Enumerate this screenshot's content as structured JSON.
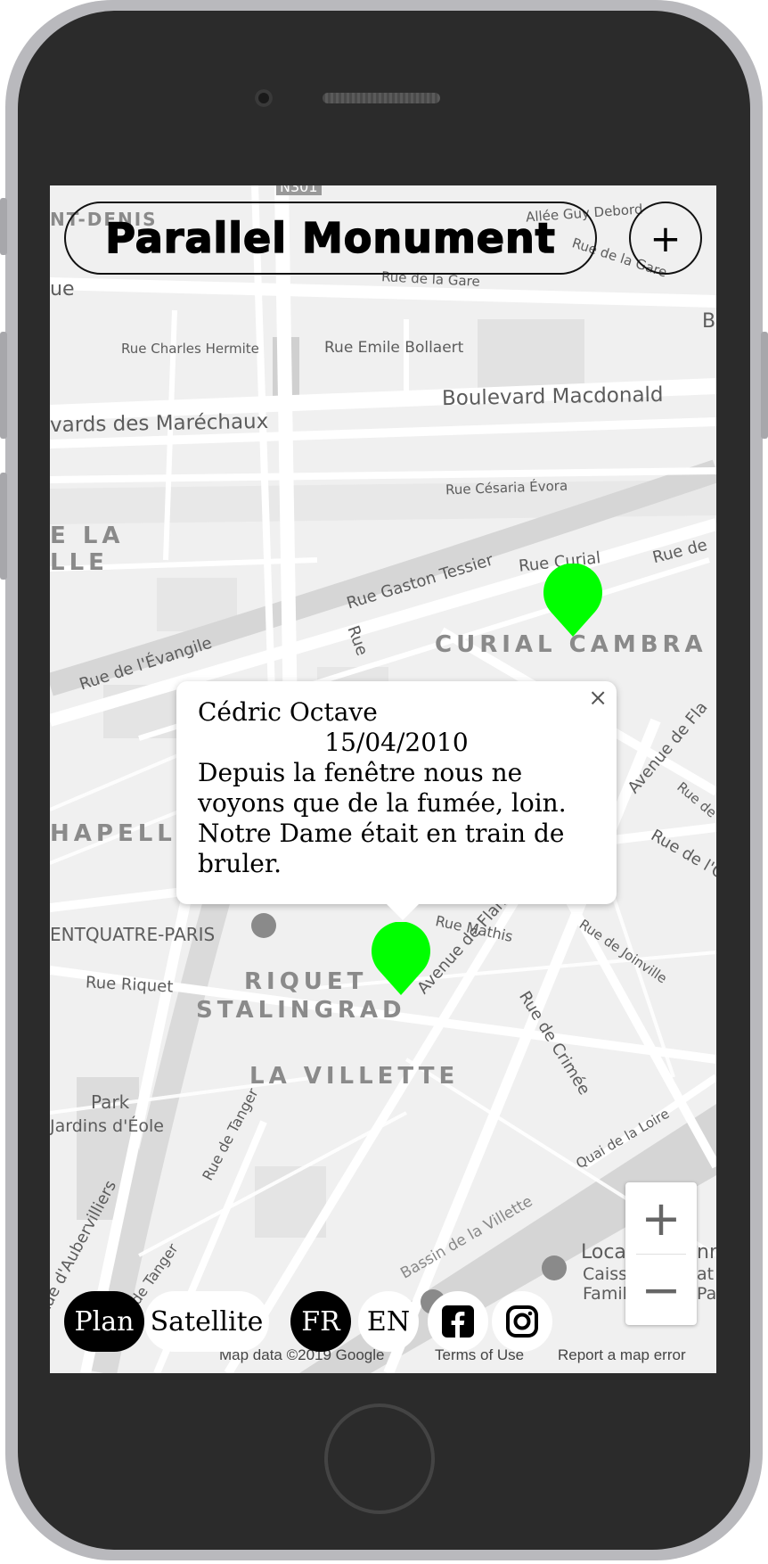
{
  "header": {
    "title": "Parallel Monument",
    "add_label": "+"
  },
  "map": {
    "labels": {
      "road_n301": "N301",
      "allee_guy_debord": "Allée Guy Debord",
      "rue_de_la_gare_1": "Rue de la Gare",
      "rue_de_la_gare_2": "Rue de la Gare",
      "st_denis": "NT-DENIS",
      "ue": "ue",
      "b_edge": "B",
      "rue_charles_hermite": "Rue Charles Hermite",
      "rue_emile_bollaert": "Rue Emile Bollaert",
      "boulevard_macdonald": "Boulevard Macdonald",
      "bd_marechaux": "vards des Maréchaux",
      "rue_cesaria_evora": "Rue Césaria Évora",
      "e_la": "E  LA",
      "lle": "LLE",
      "rue_gaston_tessier": "Rue Gaston Tessier",
      "rue_curial": "Rue Curial",
      "rue_de": "Rue de",
      "curial_cambrai": "CURIAL CAMBRA",
      "rue_evangile": "Rue de l'Évangile",
      "rue_r": "Rue",
      "chapelle": "HAPELL",
      "avenue_flandre_top": "Avenue de Fla",
      "rue_de_small": "Rue de",
      "rue_de_lo": "Rue de l'O",
      "centquatre": "ENTQUATRE-PARIS",
      "rue_mathis": "Rue Mathis",
      "rue_joinville": "Rue de Joinville",
      "riquet": "RIQUET",
      "rue_riquet": "Rue Riquet",
      "stalingrad": "STALINGRAD",
      "avenue_flandre": "Avenue de Flandre",
      "rue_crimee": "Rue de Crimée",
      "la_villette": "LA VILLETTE",
      "park": "Park",
      "jardins_eole": "Jardins d'Éole",
      "rue_tanger_1": "Rue de Tanger",
      "quai_loire": "Quai de la Loire",
      "rue_aubervilliers": "Rue d'Aubervilliers",
      "bassin_villette": "Bassin de la Villette",
      "rue_tanger_2": "ue de Tanger",
      "loca": "Loca",
      "caisse": "Caisse",
      "famili": "Famili",
      "nn": "nn",
      "at": "at",
      "pa": "Pa"
    },
    "markers": [
      {
        "color": "#00ff00"
      },
      {
        "color": "#00ff00"
      }
    ]
  },
  "info_window": {
    "name": "Cédric Octave",
    "date": "15/04/2010",
    "text": "Depuis la fenêtre nous ne voyons que de la fumée, loin. Notre Dame était en train de bruler.",
    "close_label": "×"
  },
  "zoom": {
    "in_label": "+",
    "out_label": "−"
  },
  "bottom_bar": {
    "plan_label": "Plan",
    "satellite_label": "Satellite",
    "fr_label": "FR",
    "en_label": "EN"
  },
  "footer": {
    "map_data": "Map data ©2019 Google",
    "terms": "Terms of Use",
    "report": "Report a map error"
  },
  "colors": {
    "marker": "#00ff00",
    "phone_body": "#2b2b2b",
    "phone_frame": "#b9b9bd"
  }
}
